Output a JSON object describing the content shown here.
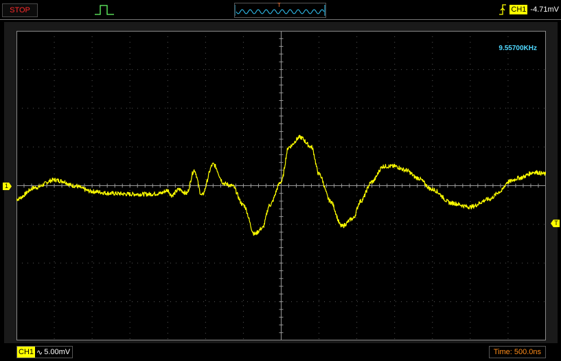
{
  "status": {
    "run_state": "STOP"
  },
  "trigger": {
    "channel": "CH1",
    "level": "-4.71mV",
    "edge": "rising",
    "position_marker": "T"
  },
  "measurements": {
    "frequency": "9.55700KHz"
  },
  "markers": {
    "channel_ref": "1",
    "trigger_level": "T"
  },
  "channel": {
    "name": "CH1",
    "coupling": "AC",
    "volts_per_div": "5.00mV"
  },
  "timebase": {
    "label": "Time: 500.0ns"
  },
  "colors": {
    "trace": "#ffff00",
    "grid": "#5a5a5a",
    "stop": "#ff2a2a",
    "frequency": "#4fd8ff",
    "timebase": "#ff8c1a",
    "trigger_icon": "#66ff66"
  },
  "chart_data": {
    "type": "line",
    "xlabel": "",
    "ylabel": "",
    "x_divisions": 14,
    "y_divisions": 8,
    "x": [
      0.0,
      0.5,
      1.0,
      1.2,
      1.5,
      2.0,
      2.5,
      3.0,
      3.5,
      3.8,
      4.0,
      4.1,
      4.3,
      4.5,
      4.7,
      4.9,
      5.2,
      5.5,
      5.7,
      6.0,
      6.3,
      6.5,
      6.7,
      7.0,
      7.2,
      7.5,
      7.8,
      8.0,
      8.3,
      8.6,
      8.9,
      9.1,
      9.4,
      9.7,
      10.0,
      10.3,
      10.6,
      11.0,
      11.5,
      12.0,
      12.5,
      12.8,
      13.0,
      13.3,
      13.7,
      14.0
    ],
    "values": [
      -0.35,
      -0.05,
      0.15,
      0.12,
      0.0,
      -0.15,
      -0.2,
      -0.22,
      -0.22,
      -0.2,
      -0.12,
      -0.25,
      -0.1,
      -0.2,
      0.4,
      -0.25,
      0.55,
      0.05,
      0.0,
      -0.5,
      -1.25,
      -1.1,
      -0.5,
      0.1,
      1.0,
      1.25,
      1.0,
      0.3,
      -0.4,
      -1.05,
      -0.85,
      -0.4,
      0.1,
      0.5,
      0.5,
      0.4,
      0.2,
      -0.1,
      -0.45,
      -0.55,
      -0.35,
      -0.15,
      0.1,
      0.2,
      0.35,
      0.3
    ],
    "ylim": [
      -4,
      4
    ],
    "grid": true
  }
}
